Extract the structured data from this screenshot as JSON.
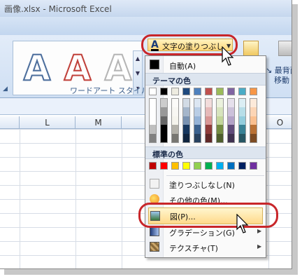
{
  "window": {
    "title": "画像.xlsx - Microsoft Excel"
  },
  "wordart": {
    "letters": [
      "A",
      "A",
      "A"
    ],
    "group_label": "ワードアート スタイル"
  },
  "ribbon_right": {
    "label1": "最背面",
    "label2": "移動"
  },
  "fill_button": {
    "icon_letter": "A",
    "label": "文字の塗りつぶし"
  },
  "columns": [
    "L",
    "M",
    "N",
    "O"
  ],
  "menu": {
    "auto_label": "自動(A)",
    "theme_header": "テーマの色",
    "standard_header": "標準の色",
    "no_fill_label": "塗りつぶしなし(N)",
    "more_colors_label": "その他の色(M)...",
    "picture_label": "図(P)...",
    "gradient_label": "グラデーション(G)",
    "texture_label": "テクスチャ(T)"
  },
  "colors": {
    "theme_top": [
      "#ffffff",
      "#000000",
      "#eeece1",
      "#1f497d",
      "#4f81bd",
      "#c0504d",
      "#9bbb59",
      "#8064a2",
      "#4bacc6",
      "#f79646"
    ],
    "standard": [
      "#c00000",
      "#ff0000",
      "#ffc000",
      "#ffff00",
      "#92d050",
      "#00b050",
      "#00b0f0",
      "#0070c0",
      "#002060",
      "#7030a0"
    ],
    "accent_red": "#c8262a"
  }
}
